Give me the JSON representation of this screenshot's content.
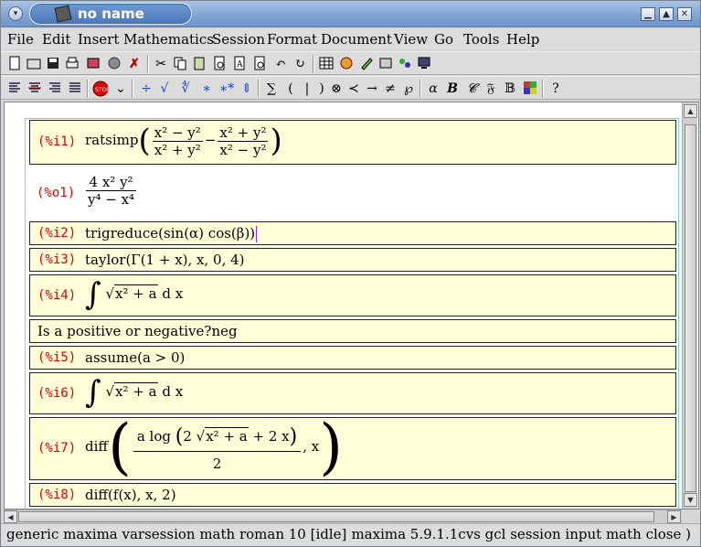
{
  "window": {
    "title": "no name"
  },
  "menu": [
    "File",
    "Edit",
    "Insert",
    "Mathematics",
    "Session",
    "Format",
    "Document",
    "View",
    "Go",
    "Tools",
    "Help"
  ],
  "toolbar_row1": [
    "new-document-icon",
    "open-folder-icon",
    "save-disk-icon",
    "print-icon",
    "export-icon",
    "web-icon",
    "close-x-icon",
    "cut-icon",
    "copy-icon",
    "paste-icon",
    "preview-icon",
    "search-icon",
    "replace-icon",
    "undo-icon",
    "redo-icon",
    "table-icon",
    "color-icon",
    "pen-icon",
    "window-icon",
    "spell-icon",
    "screen-icon"
  ],
  "toolbar_row2_symbols": [
    "÷",
    "√",
    "∜",
    "∗",
    "∗*",
    "⇕",
    "∑",
    "(",
    "|",
    ")",
    "⊗",
    "≺",
    "→",
    "≠",
    "℘",
    "α",
    "B",
    "𝓒",
    "𝔉",
    "𝔹",
    "?"
  ],
  "session": {
    "i1": {
      "label": "(%i1)",
      "cmd": "ratsimp",
      "num1": "x² − y²",
      "den1": "x² + y²",
      "op": "−",
      "num2": "x² + y²",
      "den2": "x² − y²"
    },
    "o1": {
      "label": "(%o1)",
      "num": "4 x² y²",
      "den": "y⁴ − x⁴"
    },
    "i2": {
      "label": "(%i2)",
      "text": "trigreduce(sin(α) cos(β))"
    },
    "i3": {
      "label": "(%i3)",
      "text": "taylor(Γ(1 + x), x, 0, 4)"
    },
    "i4": {
      "label": "(%i4)",
      "integrand": "x² + a",
      "tail": "d x"
    },
    "prompt": {
      "text": "Is a positive or negative?neg"
    },
    "i5": {
      "label": "(%i5)",
      "text": "assume(a > 0)"
    },
    "i6": {
      "label": "(%i6)",
      "integrand": "x² + a",
      "tail": "d x"
    },
    "i7": {
      "label": "(%i7)",
      "cmd": "diff",
      "num_a": "a log",
      "num_b": "2",
      "radicand": "x² + a",
      "num_c": "+ 2 x",
      "den": "2",
      "tail": ", x"
    },
    "i8": {
      "label": "(%i8)",
      "text": "diff(f(x), x, 2)"
    }
  },
  "status": {
    "left": "generic maxima varsession math roman 10 [idle]",
    "right": "maxima 5.9.1.1cvs gcl session input math close )"
  }
}
